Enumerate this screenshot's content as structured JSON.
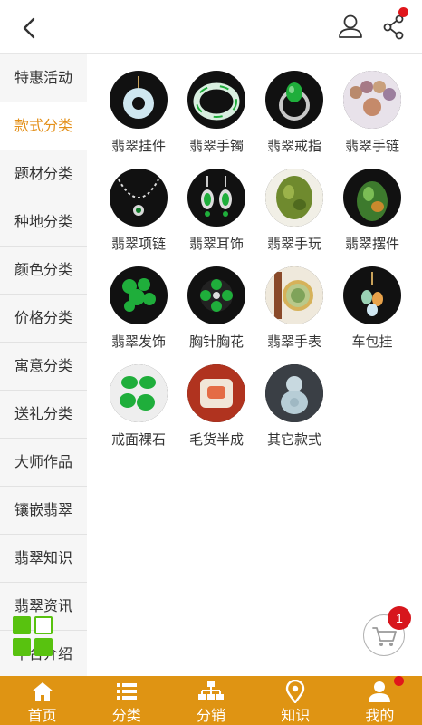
{
  "header": {
    "back_icon": "chevron-left-icon",
    "user_icon": "user-icon",
    "share_icon": "share-icon",
    "share_has_notification": true
  },
  "sidebar": {
    "items": [
      {
        "label": "特惠活动",
        "active": false
      },
      {
        "label": "款式分类",
        "active": true
      },
      {
        "label": "题材分类",
        "active": false
      },
      {
        "label": "种地分类",
        "active": false
      },
      {
        "label": "颜色分类",
        "active": false
      },
      {
        "label": "价格分类",
        "active": false
      },
      {
        "label": "寓意分类",
        "active": false
      },
      {
        "label": "送礼分类",
        "active": false
      },
      {
        "label": "大师作品",
        "active": false
      },
      {
        "label": "镶嵌翡翠",
        "active": false
      },
      {
        "label": "翡翠知识",
        "active": false
      },
      {
        "label": "翡翠资讯",
        "active": false
      },
      {
        "label": "平台介绍",
        "active": false
      }
    ]
  },
  "categories": [
    {
      "label": "翡翠挂件",
      "image": "pendant"
    },
    {
      "label": "翡翠手镯",
      "image": "bangle"
    },
    {
      "label": "翡翠戒指",
      "image": "ring"
    },
    {
      "label": "翡翠手链",
      "image": "bracelet"
    },
    {
      "label": "翡翠项链",
      "image": "necklace"
    },
    {
      "label": "翡翠耳饰",
      "image": "earrings"
    },
    {
      "label": "翡翠手玩",
      "image": "handpiece"
    },
    {
      "label": "翡翠摆件",
      "image": "ornament"
    },
    {
      "label": "翡翠发饰",
      "image": "hairpin"
    },
    {
      "label": "胸针胸花",
      "image": "brooch"
    },
    {
      "label": "翡翠手表",
      "image": "watch"
    },
    {
      "label": "车包挂",
      "image": "car-charm"
    },
    {
      "label": "戒面裸石",
      "image": "loose-stones"
    },
    {
      "label": "毛货半成",
      "image": "rough"
    },
    {
      "label": "其它款式",
      "image": "buddha"
    }
  ],
  "cart": {
    "icon": "cart-icon",
    "badge": "1"
  },
  "tabbar": {
    "items": [
      {
        "label": "首页",
        "icon": "home-icon"
      },
      {
        "label": "分类",
        "icon": "list-icon"
      },
      {
        "label": "分销",
        "icon": "org-chart-icon"
      },
      {
        "label": "知识",
        "icon": "location-pin-icon"
      },
      {
        "label": "我的",
        "icon": "user-icon",
        "has_notification": true
      }
    ]
  },
  "colors": {
    "accent": "#e3901a",
    "tabbar": "#df9413",
    "badge": "#d7161d",
    "grid_button": "#58c20f"
  }
}
